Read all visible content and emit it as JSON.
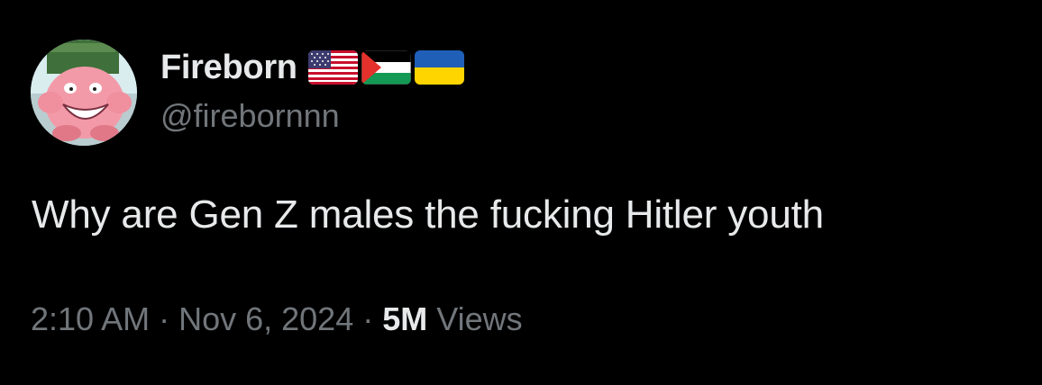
{
  "author": {
    "display_name": "Fireborn",
    "handle": "@firebornnn",
    "flags": [
      "us-flag-icon",
      "palestine-flag-icon",
      "ukraine-flag-icon"
    ]
  },
  "tweet": {
    "text": "Why are Gen Z males the fucking Hitler youth"
  },
  "meta": {
    "time": "2:10 AM",
    "separator": "·",
    "date": "Nov 6, 2024",
    "views_count": "5M",
    "views_label": "Views"
  },
  "colors": {
    "background": "#000000",
    "primary_text": "#e7e9ea",
    "secondary_text": "#71767b"
  }
}
